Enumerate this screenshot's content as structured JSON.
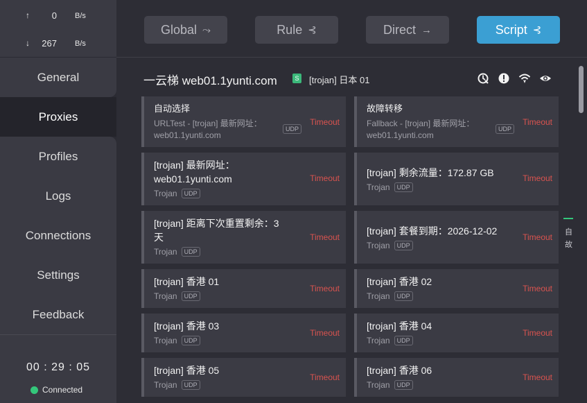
{
  "traffic": {
    "up_arrow": "↑",
    "up_value": "0",
    "up_unit": "B/s",
    "down_arrow": "↓",
    "down_value": "267",
    "down_unit": "B/s"
  },
  "nav": [
    "General",
    "Proxies",
    "Profiles",
    "Logs",
    "Connections",
    "Settings",
    "Feedback"
  ],
  "status": {
    "timer": "00 : 29 : 05",
    "connection": "Connected",
    "connection_color": "#34c77b"
  },
  "modes": [
    {
      "label": "Global",
      "icon": "⤳"
    },
    {
      "label": "Rule",
      "icon": "⊰"
    },
    {
      "label": "Direct",
      "icon": "→"
    },
    {
      "label": "Script",
      "icon": "⊰"
    }
  ],
  "active_mode_color": "#3b9fd3",
  "group": {
    "title": "一云梯 web01.1yunti.com",
    "badge": "S",
    "selected": "[trojan] 日本 01",
    "icons": [
      "latency-test-icon",
      "info-icon",
      "wifi-icon",
      "eye-icon"
    ]
  },
  "proxies": [
    {
      "name": "自动选择",
      "sub": "URLTest - [trojan] 最新网址：web01.1yunti.com",
      "udp": "UDP",
      "delay": "Timeout"
    },
    {
      "name": "故障转移",
      "sub": "Fallback - [trojan] 最新网址：web01.1yunti.com",
      "udp": "UDP",
      "delay": "Timeout"
    },
    {
      "name": "[trojan] 最新网址：web01.1yunti.com",
      "sub": "Trojan",
      "udp": "UDP",
      "delay": "Timeout"
    },
    {
      "name": "[trojan] 剩余流量：172.87 GB",
      "sub": "Trojan",
      "udp": "UDP",
      "delay": "Timeout"
    },
    {
      "name": "[trojan] 距离下次重置剩余：3 天",
      "sub": "Trojan",
      "udp": "UDP",
      "delay": "Timeout"
    },
    {
      "name": "[trojan] 套餐到期：2026-12-02",
      "sub": "Trojan",
      "udp": "UDP",
      "delay": "Timeout"
    },
    {
      "name": "[trojan] 香港 01",
      "sub": "Trojan",
      "udp": "UDP",
      "delay": "Timeout"
    },
    {
      "name": "[trojan] 香港 02",
      "sub": "Trojan",
      "udp": "UDP",
      "delay": "Timeout"
    },
    {
      "name": "[trojan] 香港 03",
      "sub": "Trojan",
      "udp": "UDP",
      "delay": "Timeout"
    },
    {
      "name": "[trojan] 香港 04",
      "sub": "Trojan",
      "udp": "UDP",
      "delay": "Timeout"
    },
    {
      "name": "[trojan] 香港 05",
      "sub": "Trojan",
      "udp": "UDP",
      "delay": "Timeout"
    },
    {
      "name": "[trojan] 香港 06",
      "sub": "Trojan",
      "udp": "UDP",
      "delay": "Timeout"
    }
  ],
  "side_group_labels": [
    "自",
    "故"
  ]
}
